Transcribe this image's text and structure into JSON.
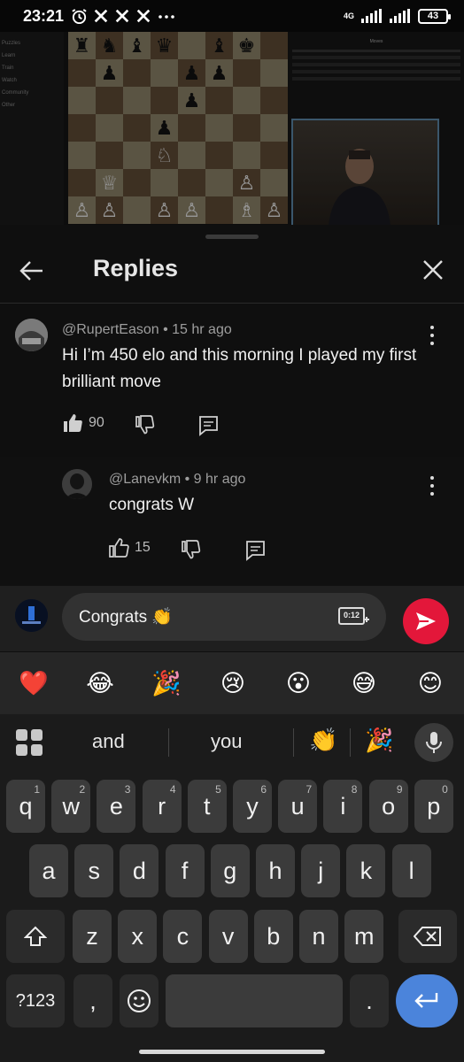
{
  "status_bar": {
    "time": "23:21",
    "icons": [
      "alarm-icon",
      "x-logo-icon",
      "x-logo-icon",
      "x-logo-icon",
      "more-dots-icon"
    ],
    "network_label": "4G",
    "battery": "43"
  },
  "video": {
    "left_nav": [
      "Puzzles",
      "Learn",
      "Train",
      "Watch",
      "Community",
      "Other"
    ],
    "move_tab": "Moves"
  },
  "replies": {
    "title": "Replies"
  },
  "comment": {
    "author": "@RupertEason",
    "time": "15 hr ago",
    "text": "Hi I’m 450 elo and this morning I played my first brilliant move",
    "likes": "90"
  },
  "reply": {
    "author": "@Lanevkm",
    "time": "9 hr ago",
    "text": "congrats W",
    "likes": "15"
  },
  "input": {
    "value": "Congrats",
    "value_emoji": "👏",
    "clip_label": "0:12",
    "send_color": "#e3173a"
  },
  "emoji_row": [
    "❤️",
    "😂",
    "🎉",
    "😢",
    "😮",
    "😅",
    "😊"
  ],
  "keyboard": {
    "suggestions": [
      "and",
      "you"
    ],
    "suggestion_emojis": [
      "👏",
      "🎉"
    ],
    "row1": [
      {
        "k": "q",
        "n": "1"
      },
      {
        "k": "w",
        "n": "2"
      },
      {
        "k": "e",
        "n": "3"
      },
      {
        "k": "r",
        "n": "4"
      },
      {
        "k": "t",
        "n": "5"
      },
      {
        "k": "y",
        "n": "6"
      },
      {
        "k": "u",
        "n": "7"
      },
      {
        "k": "i",
        "n": "8"
      },
      {
        "k": "o",
        "n": "9"
      },
      {
        "k": "p",
        "n": "0"
      }
    ],
    "row2": [
      "a",
      "s",
      "d",
      "f",
      "g",
      "h",
      "j",
      "k",
      "l"
    ],
    "row3": [
      "z",
      "x",
      "c",
      "v",
      "b",
      "n",
      "m"
    ],
    "numbers_key": "?123",
    "comma_key": ",",
    "period_key": ".",
    "accent_color": "#4b84db"
  }
}
